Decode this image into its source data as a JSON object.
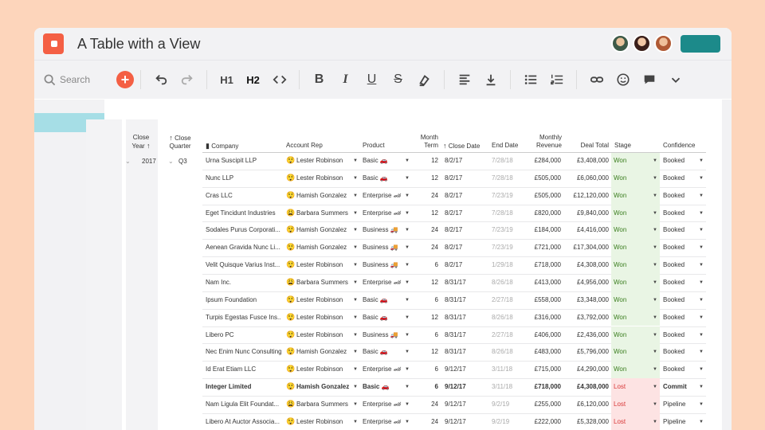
{
  "window": {
    "title": "A Table with a View"
  },
  "toolbar": {
    "search_label": "Search",
    "buttons": [
      "undo-icon",
      "redo-icon",
      "h1-icon",
      "h2-icon",
      "code-icon",
      "bold-icon",
      "italic-icon",
      "underline-icon",
      "strikethrough-icon",
      "highlight-icon",
      "align-left-icon",
      "download-icon",
      "bulleted-list-icon",
      "numbered-list-icon",
      "link-icon",
      "emoji-icon",
      "comment-icon",
      "chevron-down-icon"
    ],
    "h1_label": "H1",
    "h2_label": "H2",
    "bold_label": "B",
    "italic_label": "I",
    "underline_label": "U",
    "strike_label": "S"
  },
  "colors": {
    "accent": "#f45f44",
    "share": "#1c8a8a",
    "won_bg": "#e9f5e4",
    "lost_bg": "#fde3e3",
    "won_text": "#3a7d1e",
    "lost_text": "#d93a3a"
  },
  "table": {
    "headers": {
      "close_year": "Close Year",
      "close_quarter": "Close Quarter",
      "company": "Company",
      "account_rep": "Account Rep",
      "product": "Product",
      "month_term": "Month Term",
      "close_date": "Close Date",
      "end_date": "End Date",
      "monthly_revenue": "Monthly Revenue",
      "deal_total": "Deal Total",
      "stage": "Stage",
      "confidence": "Confidence"
    },
    "group_year": "2017",
    "group_quarter": "Q3",
    "rows": [
      {
        "company": "Urna Suscipit LLP",
        "rep": "Lester Robinson",
        "rep_emoji": "😲",
        "product": "Basic 🚗",
        "term": "12",
        "close": "8/2/17",
        "end": "7/28/18",
        "monthly": "£284,000",
        "total": "£3,408,000",
        "stage": "Won",
        "confidence": "Booked"
      },
      {
        "company": "Nunc LLP",
        "rep": "Lester Robinson",
        "rep_emoji": "😲",
        "product": "Basic 🚗",
        "term": "12",
        "close": "8/2/17",
        "end": "7/28/18",
        "monthly": "£505,000",
        "total": "£6,060,000",
        "stage": "Won",
        "confidence": "Booked"
      },
      {
        "company": "Cras LLC",
        "rep": "Hamish Gonzalez",
        "rep_emoji": "😲",
        "product": "Enterprise 🏎",
        "term": "24",
        "close": "8/2/17",
        "end": "7/23/19",
        "monthly": "£505,000",
        "total": "£12,120,000",
        "stage": "Won",
        "confidence": "Booked"
      },
      {
        "company": "Eget Tincidunt Industries",
        "rep": "Barbara Summers",
        "rep_emoji": "😩",
        "product": "Enterprise 🏎",
        "term": "12",
        "close": "8/2/17",
        "end": "7/28/18",
        "monthly": "£820,000",
        "total": "£9,840,000",
        "stage": "Won",
        "confidence": "Booked"
      },
      {
        "company": "Sodales Purus Corporati...",
        "rep": "Hamish Gonzalez",
        "rep_emoji": "😲",
        "product": "Business 🚚",
        "term": "24",
        "close": "8/2/17",
        "end": "7/23/19",
        "monthly": "£184,000",
        "total": "£4,416,000",
        "stage": "Won",
        "confidence": "Booked"
      },
      {
        "company": "Aenean Gravida Nunc Li...",
        "rep": "Hamish Gonzalez",
        "rep_emoji": "😲",
        "product": "Business 🚚",
        "term": "24",
        "close": "8/2/17",
        "end": "7/23/19",
        "monthly": "£721,000",
        "total": "£17,304,000",
        "stage": "Won",
        "confidence": "Booked"
      },
      {
        "company": "Velit Quisque Varius Inst...",
        "rep": "Lester Robinson",
        "rep_emoji": "😲",
        "product": "Business 🚚",
        "term": "6",
        "close": "8/2/17",
        "end": "1/29/18",
        "monthly": "£718,000",
        "total": "£4,308,000",
        "stage": "Won",
        "confidence": "Booked"
      },
      {
        "company": "Nam Inc.",
        "rep": "Barbara Summers",
        "rep_emoji": "😩",
        "product": "Enterprise 🏎",
        "term": "12",
        "close": "8/31/17",
        "end": "8/26/18",
        "monthly": "£413,000",
        "total": "£4,956,000",
        "stage": "Won",
        "confidence": "Booked"
      },
      {
        "company": "Ipsum Foundation",
        "rep": "Lester Robinson",
        "rep_emoji": "😲",
        "product": "Basic 🚗",
        "term": "6",
        "close": "8/31/17",
        "end": "2/27/18",
        "monthly": "£558,000",
        "total": "£3,348,000",
        "stage": "Won",
        "confidence": "Booked"
      },
      {
        "company": "Turpis Egestas Fusce Ins...",
        "rep": "Lester Robinson",
        "rep_emoji": "😲",
        "product": "Basic 🚗",
        "term": "12",
        "close": "8/31/17",
        "end": "8/26/18",
        "monthly": "£316,000",
        "total": "£3,792,000",
        "stage": "Won",
        "confidence": "Booked"
      },
      {
        "company": "Libero PC",
        "rep": "Lester Robinson",
        "rep_emoji": "😲",
        "product": "Business 🚚",
        "term": "6",
        "close": "8/31/17",
        "end": "2/27/18",
        "monthly": "£406,000",
        "total": "£2,436,000",
        "stage": "Won",
        "confidence": "Booked"
      },
      {
        "company": "Nec Enim Nunc Consulting",
        "rep": "Hamish Gonzalez",
        "rep_emoji": "😲",
        "product": "Basic 🚗",
        "term": "12",
        "close": "8/31/17",
        "end": "8/26/18",
        "monthly": "£483,000",
        "total": "£5,796,000",
        "stage": "Won",
        "confidence": "Booked"
      },
      {
        "company": "Id Erat Etiam LLC",
        "rep": "Lester Robinson",
        "rep_emoji": "😲",
        "product": "Enterprise 🏎",
        "term": "6",
        "close": "9/12/17",
        "end": "3/11/18",
        "monthly": "£715,000",
        "total": "£4,290,000",
        "stage": "Won",
        "confidence": "Booked"
      },
      {
        "company": "Integer Limited",
        "rep": "Hamish Gonzalez",
        "rep_emoji": "😲",
        "product": "Basic 🚗",
        "term": "6",
        "close": "9/12/17",
        "end": "3/11/18",
        "monthly": "£718,000",
        "total": "£4,308,000",
        "stage": "Lost",
        "confidence": "Commit",
        "bold": true
      },
      {
        "company": "Nam Ligula Elit Foundat...",
        "rep": "Barbara Summers",
        "rep_emoji": "😩",
        "product": "Enterprise 🏎",
        "term": "24",
        "close": "9/12/17",
        "end": "9/2/19",
        "monthly": "£255,000",
        "total": "£6,120,000",
        "stage": "Lost",
        "confidence": "Pipeline"
      },
      {
        "company": "Libero At Auctor Associa...",
        "rep": "Lester Robinson",
        "rep_emoji": "😲",
        "product": "Enterprise 🏎",
        "term": "24",
        "close": "9/12/17",
        "end": "9/2/19",
        "monthly": "£222,000",
        "total": "£5,328,000",
        "stage": "Lost",
        "confidence": "Pipeline"
      }
    ]
  }
}
